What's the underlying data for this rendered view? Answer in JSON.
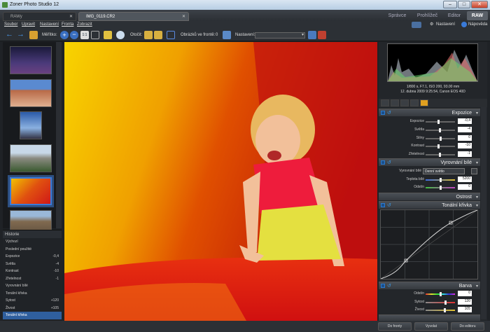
{
  "window": {
    "title": "Zoner Photo Studio 12"
  },
  "files": {
    "tab1": "RAWy",
    "tab2": "IMG_0119.CR2"
  },
  "modes": [
    {
      "label": "Správce"
    },
    {
      "label": "Prohlížeč"
    },
    {
      "label": "Editor"
    },
    {
      "label": "RAW"
    }
  ],
  "menu": [
    "Soubor",
    "Upravit",
    "Nastavení",
    "Fronta",
    "Zobrazit"
  ],
  "toolbar": {
    "scale_label": "Měřítko:",
    "rotate_label": "Otočit:",
    "queue_label": "Obrázků ve frontě:",
    "queue_count": "0",
    "preset_label": "Nastavení:"
  },
  "top_right": {
    "settings": "Nastavení",
    "help": "Nápověda"
  },
  "history": {
    "title": "Historie",
    "items": [
      {
        "label": "Výchozí",
        "value": ""
      },
      {
        "label": "Poslední použité",
        "value": ""
      },
      {
        "label": "Expozice",
        "value": "-0,4"
      },
      {
        "label": "Světla",
        "value": "-4"
      },
      {
        "label": "Kontrast",
        "value": "-10"
      },
      {
        "label": "Zřetelnost",
        "value": "-1"
      },
      {
        "label": "Vyrovnání bílé",
        "value": ""
      },
      {
        "label": "Tonální křivka",
        "value": ""
      },
      {
        "label": "Sytost",
        "value": "+120"
      },
      {
        "label": "Živost",
        "value": "+105"
      },
      {
        "label": "Tonální křivka",
        "value": ""
      }
    ]
  },
  "exif": {
    "line1": "1/800 s, F7.1, ISO 200, 93.00 mm",
    "line2": "12. dubna 2009 9:25:54, Canon EOS 40D"
  },
  "sections": {
    "exposure": "Expozice",
    "wb": "Vyrovnání bílé",
    "sharpness": "Ostrost",
    "curve": "Tonální křivka",
    "color": "Barva"
  },
  "exposure": [
    {
      "label": "Expozice",
      "value": "-0,4"
    },
    {
      "label": "Světla",
      "value": "-4"
    },
    {
      "label": "Stíny",
      "value": "0"
    },
    {
      "label": "Kontrast",
      "value": "-10"
    },
    {
      "label": "Zřetelnost",
      "value": "-1"
    }
  ],
  "wb": {
    "label": "Vyrovnání bílé",
    "preset": "Denní světlo",
    "temp_label": "Teplota bílé",
    "temp": "5200",
    "tint_label": "Odstín",
    "tint": "0"
  },
  "color": [
    {
      "label": "Odstín",
      "value": "0"
    },
    {
      "label": "Sytost",
      "value": "120"
    },
    {
      "label": "Živost",
      "value": "105"
    }
  ],
  "buttons": {
    "queue": "Do fronty",
    "develop": "Vyvolat",
    "editor": "Do editoru"
  },
  "colors": {
    "accent": "#3a7ad8",
    "raw_tab": "#5a6068"
  }
}
